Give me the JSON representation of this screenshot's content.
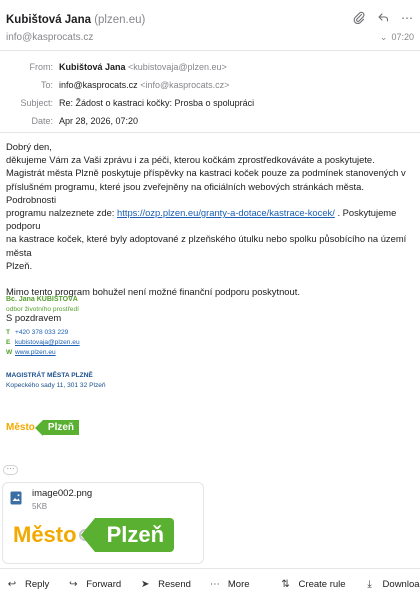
{
  "header": {
    "sender_name": "Kubištová Jana",
    "sender_addr": "(plzen.eu)",
    "account": "info@kasprocats.cz",
    "time": "07:20"
  },
  "meta": {
    "from_label": "From:",
    "from_name": "Kubištová Jana",
    "from_addr": "<kubistovaja@plzen.eu>",
    "to_label": "To:",
    "to_addr": "info@kasprocats.cz",
    "to_addr_full": "<info@kasprocats.cz>",
    "subject_label": "Subject:",
    "subject": "Re: Žádost o kastraci kočky: Prosba o spolupráci",
    "date_label": "Date:",
    "date": "Apr 28, 2026, 07:20"
  },
  "body": {
    "greeting": "Dobrý den,",
    "line1": "děkujeme Vám za Vaši zprávu i za péči, kterou kočkám zprostředkováváte a poskytujete.",
    "line2": "Magistrát města Plzně poskytuje příspěvky na kastraci koček pouze za podmínek stanovených v",
    "line3": "příslušném programu, které jsou zveřejněny na oficiálních webových stránkách města. Podrobnosti",
    "line4_pre": "programu nalzeznete zde: ",
    "link": "https://ozp.plzen.eu/granty-a-dotace/kastrace-kocek/",
    "line4_post": " . Poskytujeme podporu",
    "line5": "na kastrace koček, které byly adoptované z plzeňského útulku nebo spolku působícího na území města",
    "line6": "Plzeň.",
    "line7": "Mimo tento program bohužel není možné finanční podporu poskytnout.",
    "closing": "S pozdravem"
  },
  "signature": {
    "name": "Bc. Jana KUBIŠTOVÁ",
    "dept": "odbor životního prostředí",
    "t_key": "T",
    "phone": "+420 378 033 229",
    "e_key": "E",
    "email": "kubistovaja@plzen.eu",
    "w_key": "W",
    "web": "www.plzen.eu",
    "org": "MAGISTRÁT MĚSTA PLZNĚ",
    "address": "Kopeckého sady 11, 301 32  Plzeň"
  },
  "logo": {
    "word1": "Město",
    "word2": "Plzeň",
    "color_orange": "#f2a900",
    "color_green": "#5ab031"
  },
  "attachment": {
    "name": "image002.png",
    "size": "5KB"
  },
  "toolbar": {
    "reply": "Reply",
    "forward": "Forward",
    "resend": "Resend",
    "more": "More",
    "create_rule": "Create rule",
    "download": "Download"
  }
}
